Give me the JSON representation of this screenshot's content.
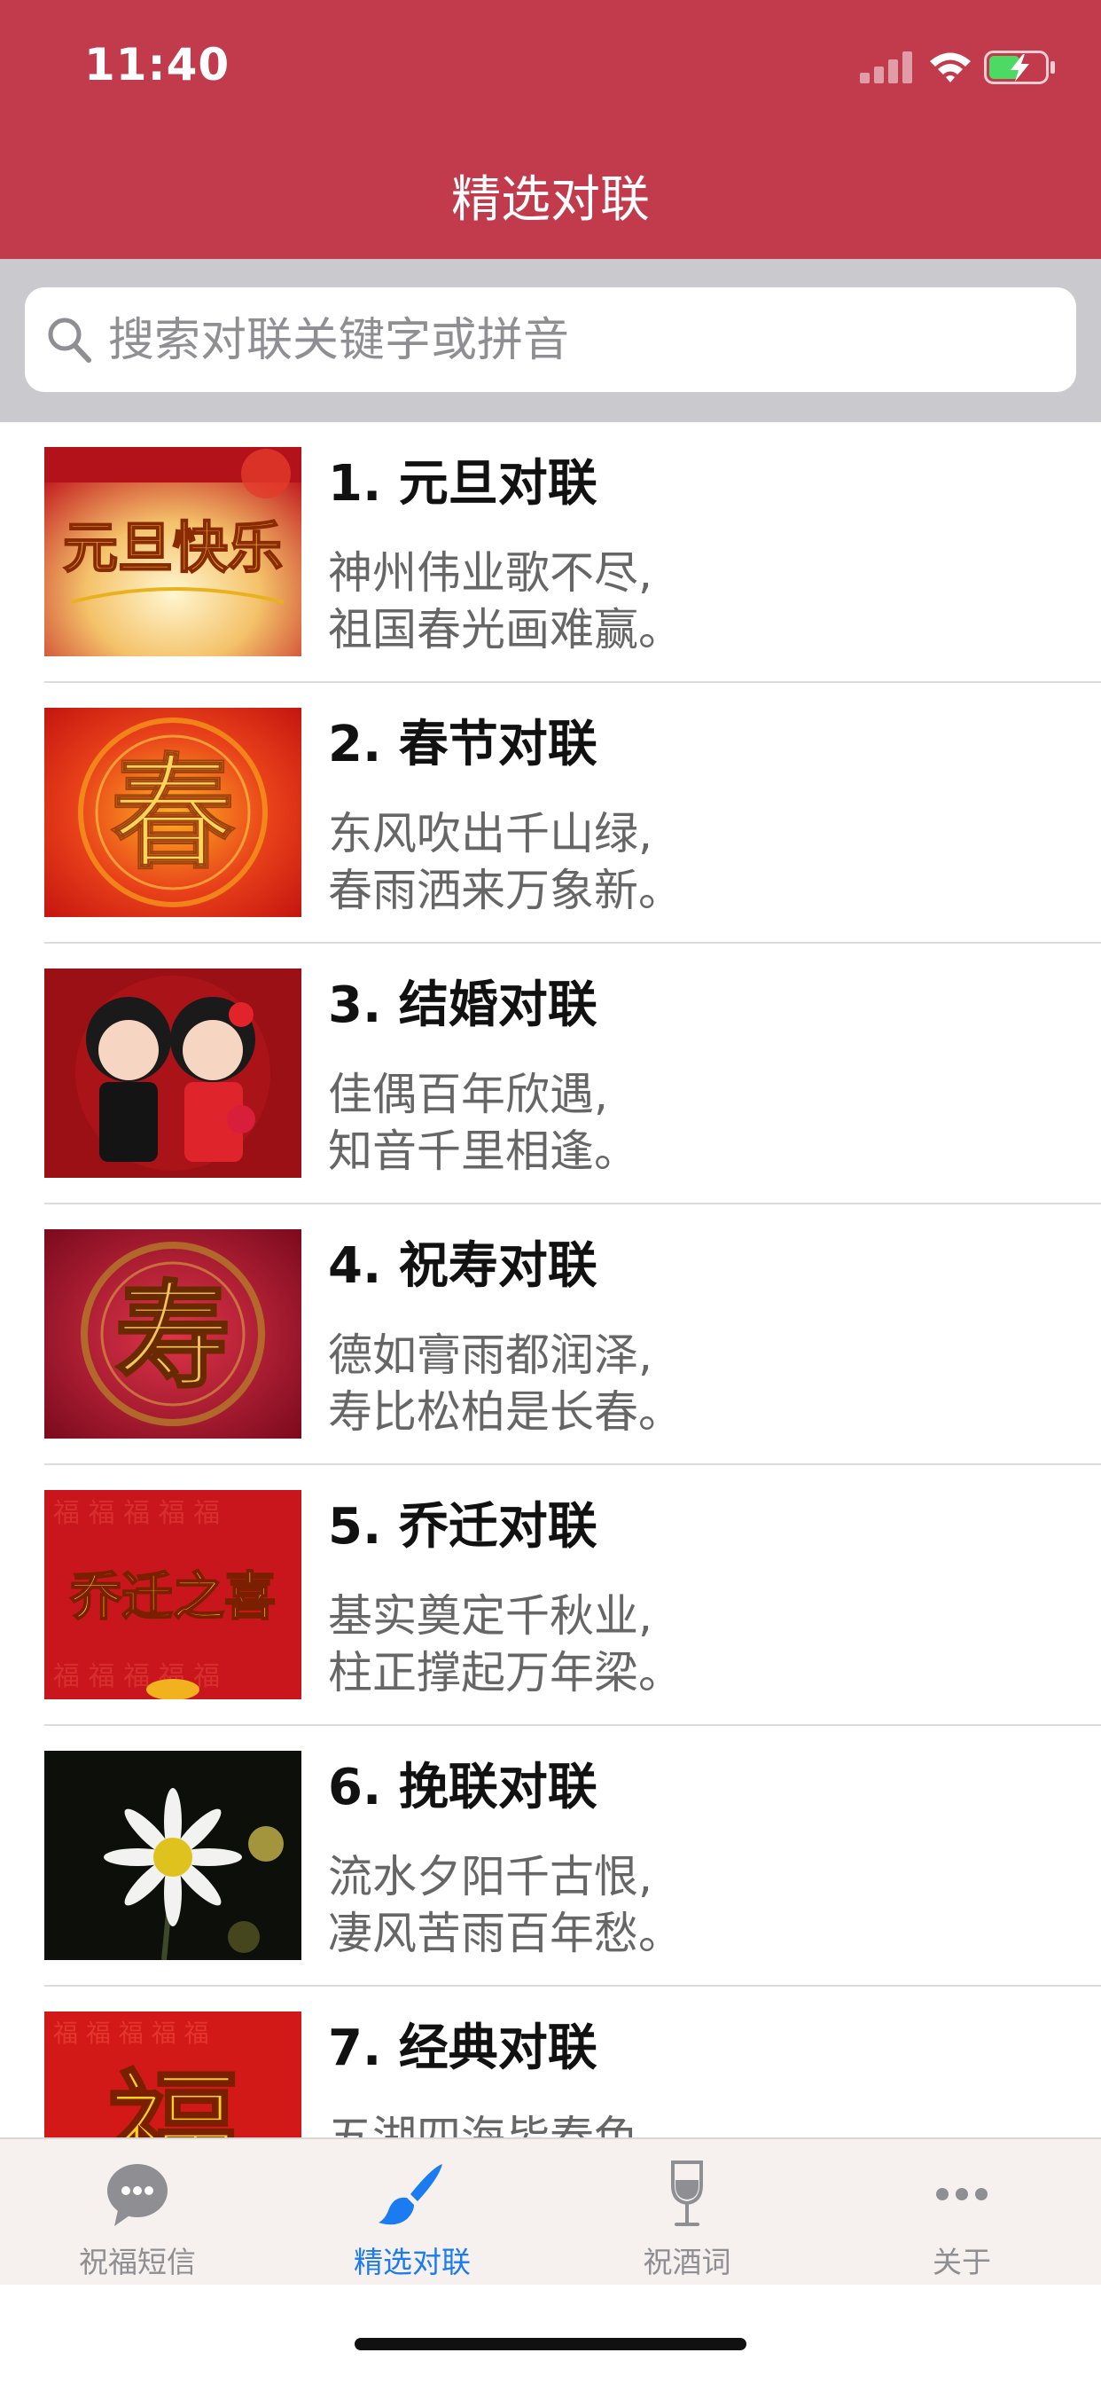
{
  "status_bar": {
    "time": "11:40"
  },
  "nav": {
    "title": "精选对联"
  },
  "search": {
    "placeholder": "搜索对联关键字或拼音",
    "value": ""
  },
  "list": {
    "items": [
      {
        "title": "1. 元旦对联",
        "line1": "神州伟业歌不尽,",
        "line2": "祖国春光画难赢。",
        "thumb_text": "元旦快乐"
      },
      {
        "title": "2. 春节对联",
        "line1": "东风吹出千山绿,",
        "line2": "春雨洒来万象新。",
        "thumb_text": "春"
      },
      {
        "title": "3. 结婚对联",
        "line1": "佳偶百年欣遇,",
        "line2": "知音千里相逢。",
        "thumb_text": ""
      },
      {
        "title": "4. 祝寿对联",
        "line1": "德如膏雨都润泽,",
        "line2": "寿比松柏是长春。",
        "thumb_text": "寿"
      },
      {
        "title": "5. 乔迁对联",
        "line1": "基实奠定千秋业,",
        "line2": "柱正撑起万年梁。",
        "thumb_text": "乔迁之喜"
      },
      {
        "title": "6. 挽联对联",
        "line1": "流水夕阳千古恨,",
        "line2": "凄风苦雨百年愁。",
        "thumb_text": ""
      },
      {
        "title": "7. 经典对联",
        "line1": "五湖四海皆春色",
        "line2": "",
        "thumb_text": "福"
      }
    ]
  },
  "tabbar": {
    "tabs": [
      {
        "label": "祝福短信",
        "icon": "chat-bubble-icon",
        "active": false
      },
      {
        "label": "精选对联",
        "icon": "brush-icon",
        "active": true
      },
      {
        "label": "祝酒词",
        "icon": "wine-glass-icon",
        "active": false
      },
      {
        "label": "关于",
        "icon": "more-dots-icon",
        "active": false
      }
    ]
  },
  "colors": {
    "brand_red": "#c23b4c",
    "active_tab": "#1a7cf0",
    "inactive_tab": "#8e8e93",
    "battery_green": "#4cd964"
  }
}
